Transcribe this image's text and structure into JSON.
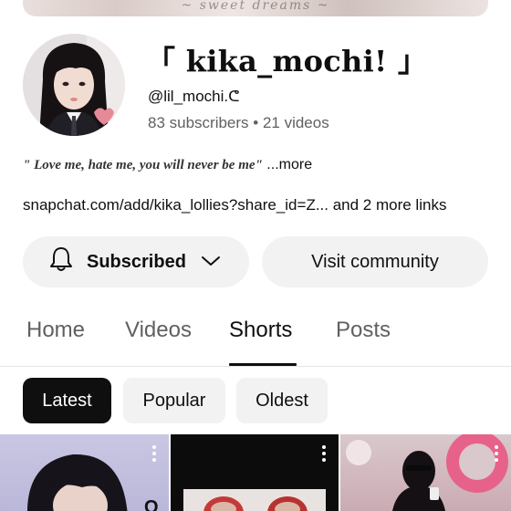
{
  "banner": {
    "script_text": "~ sweet dreams ~"
  },
  "channel": {
    "name": "「 kika_mochi!  」",
    "handle": "@lil_mochi.ᕦ",
    "stats": "83 subscribers • 21 videos",
    "description_quote": "\" Love me, hate me, you will never be me\"",
    "description_more": " ...more",
    "links": "snapchat.com/add/kika_lollies?share_id=Z... and 2 more links"
  },
  "actions": {
    "subscribed_label": "Subscribed",
    "community_label": "Visit community"
  },
  "tabs": [
    {
      "label": "Home",
      "active": false
    },
    {
      "label": "Videos",
      "active": false
    },
    {
      "label": "Shorts",
      "active": true
    },
    {
      "label": "Posts",
      "active": false
    }
  ],
  "filters": [
    {
      "label": "Latest",
      "selected": true
    },
    {
      "label": "Popular",
      "selected": false
    },
    {
      "label": "Oldest",
      "selected": false
    }
  ],
  "icons": {
    "bell": "bell-icon",
    "chevron": "chevron-down-icon",
    "more": "more-vert-icon"
  },
  "colors": {
    "chip_selected": "#0f0f0f",
    "button_bg": "#f2f2f2",
    "secondary_text": "#606060"
  }
}
